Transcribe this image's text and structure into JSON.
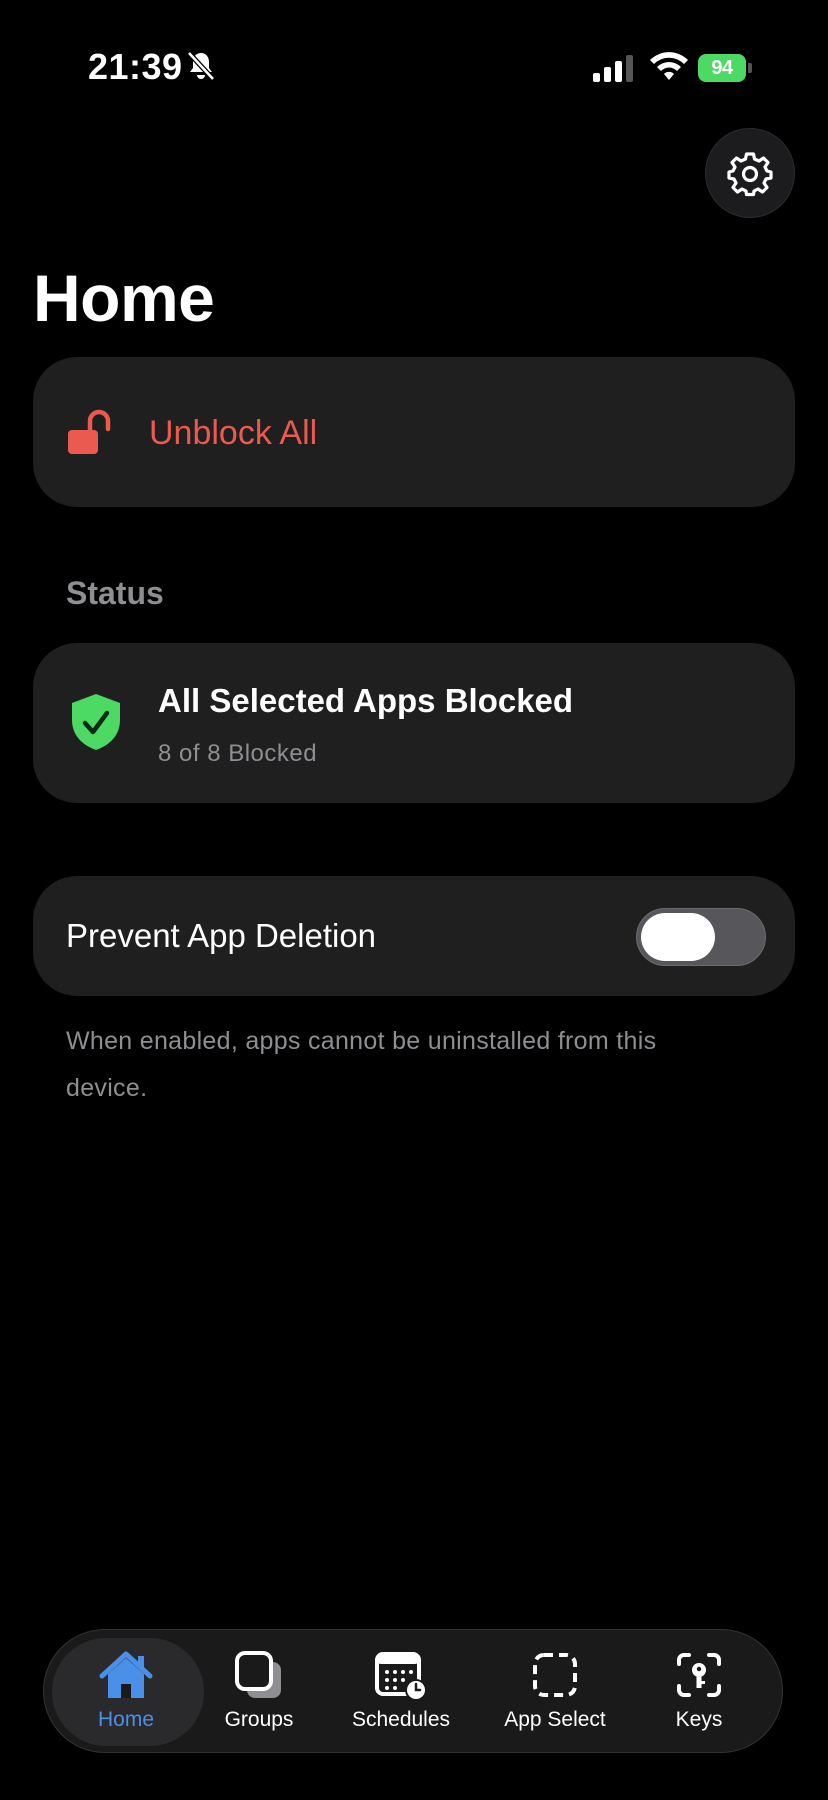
{
  "status_bar": {
    "time": "21:39",
    "battery": "94"
  },
  "page": {
    "title": "Home"
  },
  "unblock": {
    "label": "Unblock All"
  },
  "status": {
    "section_label": "Status",
    "title": "All Selected Apps Blocked",
    "subtitle": "8 of 8 Blocked"
  },
  "prevent_deletion": {
    "label": "Prevent App Deletion",
    "enabled": false,
    "footnote": "When enabled, apps cannot be uninstalled from this device."
  },
  "tabs": [
    {
      "label": "Home",
      "icon": "house-icon",
      "active": true
    },
    {
      "label": "Groups",
      "icon": "stacked-squares-icon",
      "active": false
    },
    {
      "label": "Schedules",
      "icon": "calendar-clock-icon",
      "active": false
    },
    {
      "label": "App Select",
      "icon": "dashed-square-icon",
      "active": false
    },
    {
      "label": "Keys",
      "icon": "key-viewfinder-icon",
      "active": false
    }
  ],
  "colors": {
    "accent_blue": "#4a90e8",
    "unblock_red": "#eb5a4e",
    "shield_green": "#4cd964",
    "card_bg": "#1f1f1f"
  }
}
